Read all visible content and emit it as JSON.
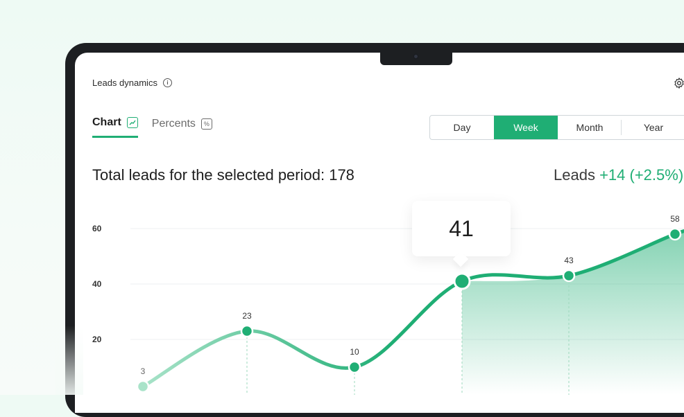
{
  "widget": {
    "title": "Leads dynamics"
  },
  "tabs": [
    {
      "label": "Chart",
      "active": true,
      "icon": "trend-chart-icon"
    },
    {
      "label": "Percents",
      "active": false,
      "icon": "percent-icon"
    }
  ],
  "period": {
    "options": [
      "Day",
      "Week",
      "Month",
      "Year"
    ],
    "selected": "Week"
  },
  "summary": {
    "total_text": "Total leads for the selected period: 178",
    "leads_label": "Leads",
    "leads_delta": "+14 (+2.5%)"
  },
  "tooltip": {
    "value": "41"
  },
  "colors": {
    "accent": "#1fae74",
    "accent_light": "#a9e3c9"
  },
  "chart_data": {
    "type": "area",
    "y_ticks": [
      "60",
      "40",
      "20"
    ],
    "ylim": [
      0,
      60
    ],
    "grid": true,
    "points": [
      {
        "value": 3,
        "label": "3"
      },
      {
        "value": 23,
        "label": "23"
      },
      {
        "value": 10,
        "label": "10"
      },
      {
        "value": 41,
        "label": ""
      },
      {
        "value": 43,
        "label": "43"
      },
      {
        "value": 58,
        "label": "58"
      }
    ]
  }
}
